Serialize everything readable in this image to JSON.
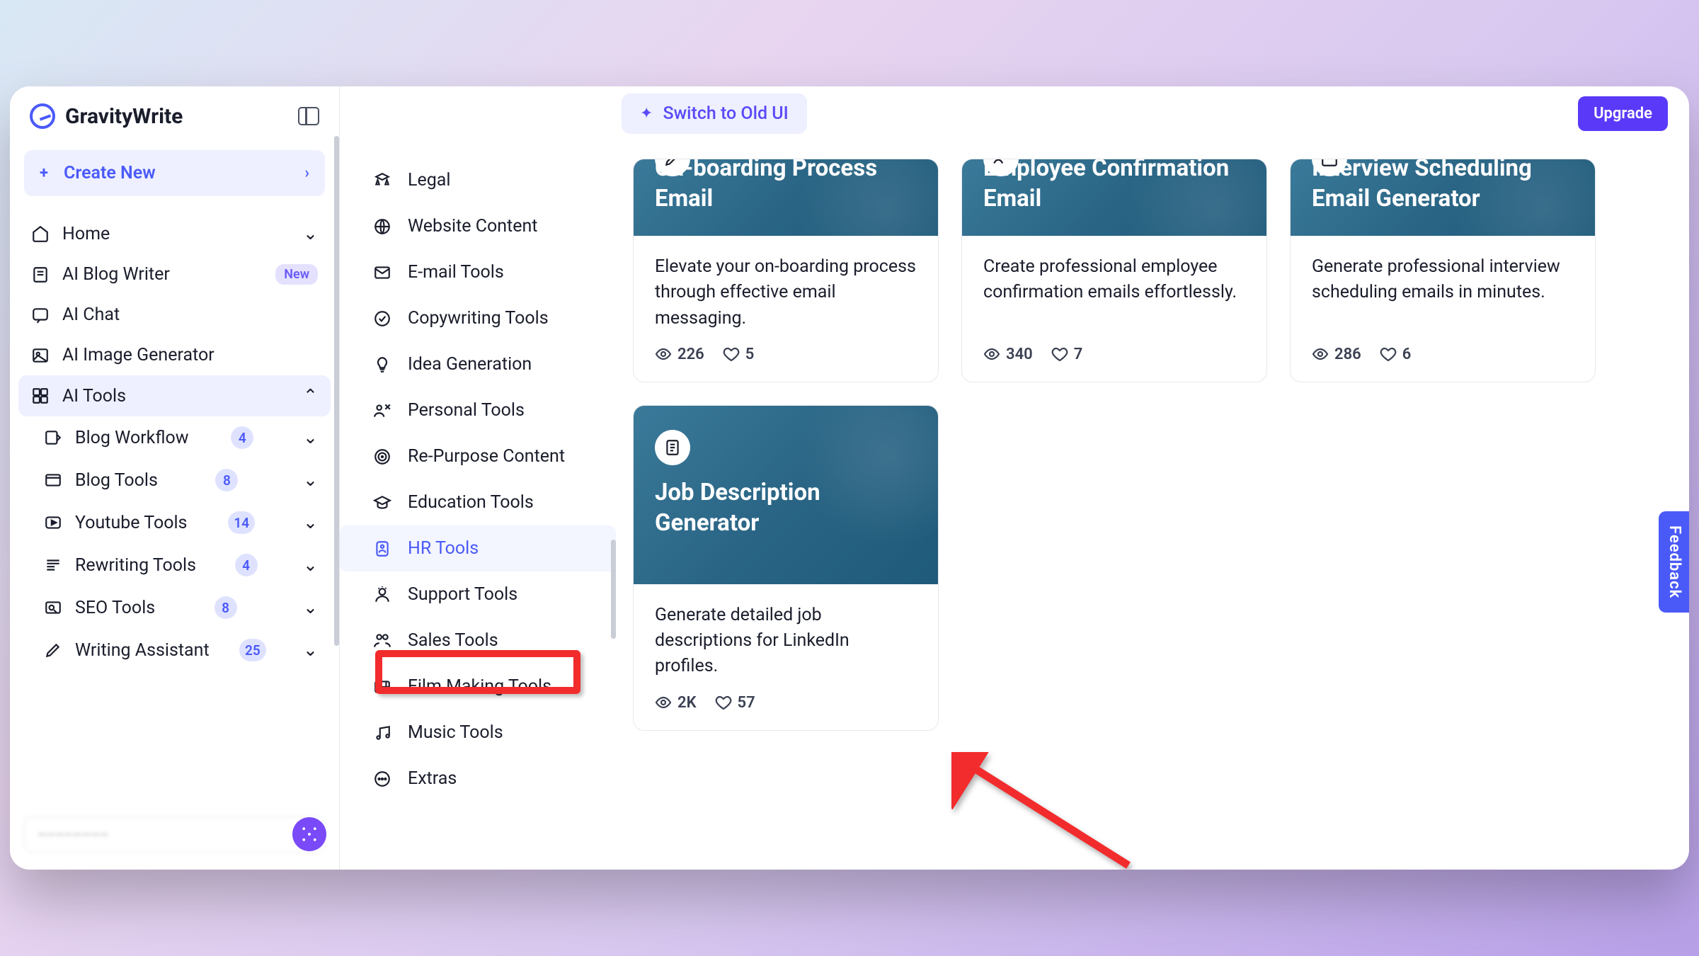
{
  "brand": "GravityWrite",
  "create_label": "Create New",
  "switch_label": "Switch to Old UI",
  "upgrade_label": "Upgrade",
  "feedback_label": "Feedback",
  "badge_new": "New",
  "nav": {
    "home": "Home",
    "blog_writer": "AI Blog Writer",
    "chat": "AI Chat",
    "image_gen": "AI Image Generator",
    "ai_tools": "AI Tools"
  },
  "subnav": [
    {
      "label": "Blog Workflow",
      "count": "4"
    },
    {
      "label": "Blog Tools",
      "count": "8"
    },
    {
      "label": "Youtube Tools",
      "count": "14"
    },
    {
      "label": "Rewriting Tools",
      "count": "4"
    },
    {
      "label": "SEO Tools",
      "count": "8"
    },
    {
      "label": "Writing Assistant",
      "count": "25"
    }
  ],
  "categories": [
    "Legal",
    "Website Content",
    "E-mail Tools",
    "Copywriting Tools",
    "Idea Generation",
    "Personal Tools",
    "Re-Purpose Content",
    "Education Tools",
    "HR Tools",
    "Support Tools",
    "Sales Tools",
    "Film Making Tools",
    "Music Tools",
    "Extras"
  ],
  "cards": [
    {
      "title": "On-boarding Process Email",
      "desc": "Elevate your on-boarding process through effective email messaging.",
      "views": "226",
      "likes": "5"
    },
    {
      "title": "Employee Confirmation Email",
      "desc": "Create professional employee confirmation emails effortlessly.",
      "views": "340",
      "likes": "7"
    },
    {
      "title": "Interview Scheduling Email Generator",
      "desc": "Generate professional interview scheduling emails in minutes.",
      "views": "286",
      "likes": "6"
    },
    {
      "title": "Job Description Generator",
      "desc": "Generate detailed job descriptions for LinkedIn profiles.",
      "views": "2K",
      "likes": "57"
    }
  ]
}
